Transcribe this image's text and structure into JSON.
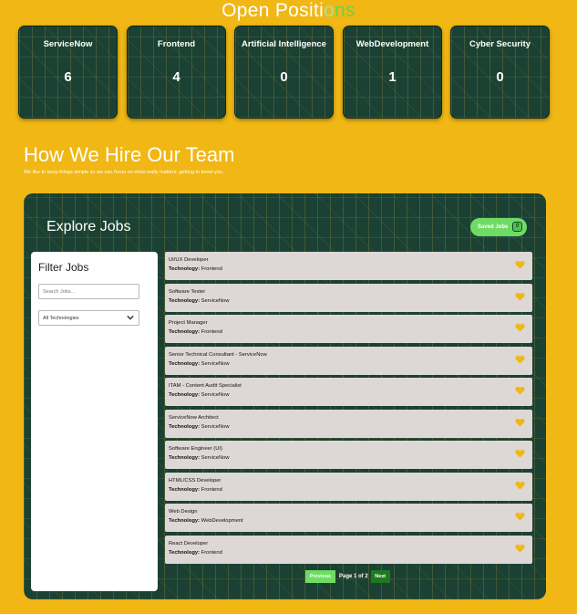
{
  "header": {
    "title_part1": "Open Positi",
    "title_part2": "o",
    "title_part3": "n",
    "title_part4": "s"
  },
  "stats": [
    {
      "label": "ServiceNow",
      "count": "6"
    },
    {
      "label": "Frontend",
      "count": "4"
    },
    {
      "label": "Artificial Intelligence",
      "count": "0"
    },
    {
      "label": "WebDevelopment",
      "count": "1"
    },
    {
      "label": "Cyber Security",
      "count": "0"
    }
  ],
  "hire": {
    "title": "How We Hire Our Team",
    "subtitle": "We like to keep things simple so we can focus on what really matters: getting to know you."
  },
  "explore": {
    "title": "Explore Jobs",
    "saved_label": "Saved Jobs",
    "saved_count": "0"
  },
  "filter": {
    "title": "Filter Jobs",
    "search_placeholder": "Search Jobs...",
    "technology_selected": "All Technologies"
  },
  "jobs": [
    {
      "title": "UI/UX Developer",
      "tech_label": "Technology:",
      "tech": "Frontend"
    },
    {
      "title": "Software Tester",
      "tech_label": "Technology:",
      "tech": "ServiceNow"
    },
    {
      "title": "Project Manager",
      "tech_label": "Technology:",
      "tech": "Frontend"
    },
    {
      "title": "Senior Technical Consultant - ServiceNow",
      "tech_label": "Technology:",
      "tech": "ServiceNow"
    },
    {
      "title": "ITAM - Content Audit Specialist",
      "tech_label": "Technology:",
      "tech": "ServiceNow"
    },
    {
      "title": "ServiceNow Architect",
      "tech_label": "Technology:",
      "tech": "ServiceNow"
    },
    {
      "title": "Software Engineer (UI)",
      "tech_label": "Technology:",
      "tech": "ServiceNow"
    },
    {
      "title": "HTML/CSS Developer",
      "tech_label": "Technology:",
      "tech": "Frontend"
    },
    {
      "title": "Web Design",
      "tech_label": "Technology:",
      "tech": "WebDevelopment"
    },
    {
      "title": "React Developer",
      "tech_label": "Technology:",
      "tech": "Frontend"
    }
  ],
  "pagination": {
    "previous": "Previous",
    "page_info": "Page 1 of 2",
    "next": "Next"
  },
  "colors": {
    "background": "#f0b715",
    "panel": "#1a4133",
    "accent_green": "#6edc64",
    "next_green": "#1e7a1e",
    "heart": "#f0b715",
    "job_card": "#ddd7d5"
  },
  "icons": {
    "heart": "heart-icon",
    "bag": "shopping-bag-icon",
    "chevron": "chevron-down-icon"
  }
}
